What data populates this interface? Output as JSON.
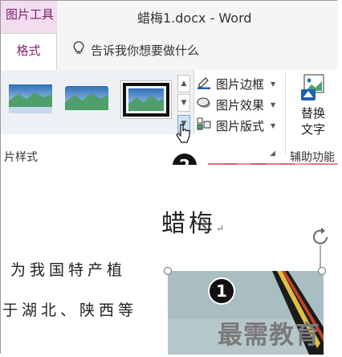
{
  "titlebar": {
    "context_tab": "图片工具",
    "doc_title": "蜡梅1.docx  -  Word"
  },
  "ribbon_tabs": {
    "format": "格式",
    "tell_me": "告诉我你想要做什么"
  },
  "picture_styles": {
    "group_label": "片样式",
    "selected_index": 2
  },
  "commands": {
    "border": "图片边框",
    "effects": "图片效果",
    "layout": "图片版式"
  },
  "replace_text": {
    "line1": "替换",
    "line2": "文字"
  },
  "accessibility": {
    "group_label": "辅助功能"
  },
  "callouts": {
    "two": "2",
    "one": "1"
  },
  "document": {
    "heading": "蜡梅",
    "para_mark": "↵",
    "line1": "为我国特产植",
    "line2": "于湖北、陕西等"
  },
  "watermark": "最需教育",
  "colors": {
    "context_tab_bg": "#f2dcef",
    "accent": "#8a2474",
    "more_button": "#cfe3f7"
  }
}
